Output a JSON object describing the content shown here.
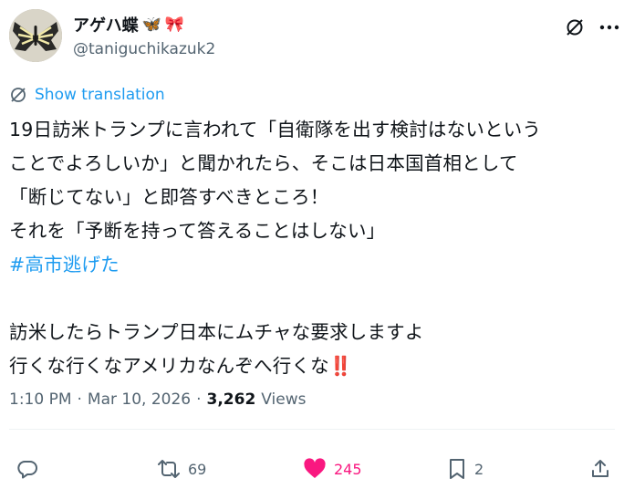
{
  "author": {
    "display_name": "アゲハ蝶",
    "emojis": [
      "🦋",
      "🎀"
    ],
    "handle": "@taniguchikazuk2"
  },
  "translate": {
    "label": "Show translation"
  },
  "tweet": {
    "lines": [
      "19日訪米トランプに言われて「自衛隊を出す検討はないという",
      "ことでよろしいか」と聞かれたら、そこは日本国首相として",
      "「断じてない」と即答すべきところ！",
      "それを「予断を持って答えることはしない」"
    ],
    "hashtag": "#高市逃げた",
    "lines2": [
      "訪米したらトランプ日本にムチャな要求しますよ",
      "行くな行くなアメリカなんぞへ行くな"
    ],
    "emphasis": "‼️"
  },
  "meta": {
    "time": "1:10 PM",
    "date": "Mar 10, 2026",
    "separator": "·",
    "views_count": "3,262",
    "views_label": "Views"
  },
  "actions": {
    "reply": {
      "count": ""
    },
    "retweet": {
      "count": "69"
    },
    "like": {
      "count": "245"
    },
    "bookmark": {
      "count": "2"
    }
  },
  "colors": {
    "text": "#0f1419",
    "secondary": "#536471",
    "link": "#1d9bf0",
    "like": "#f91880"
  }
}
